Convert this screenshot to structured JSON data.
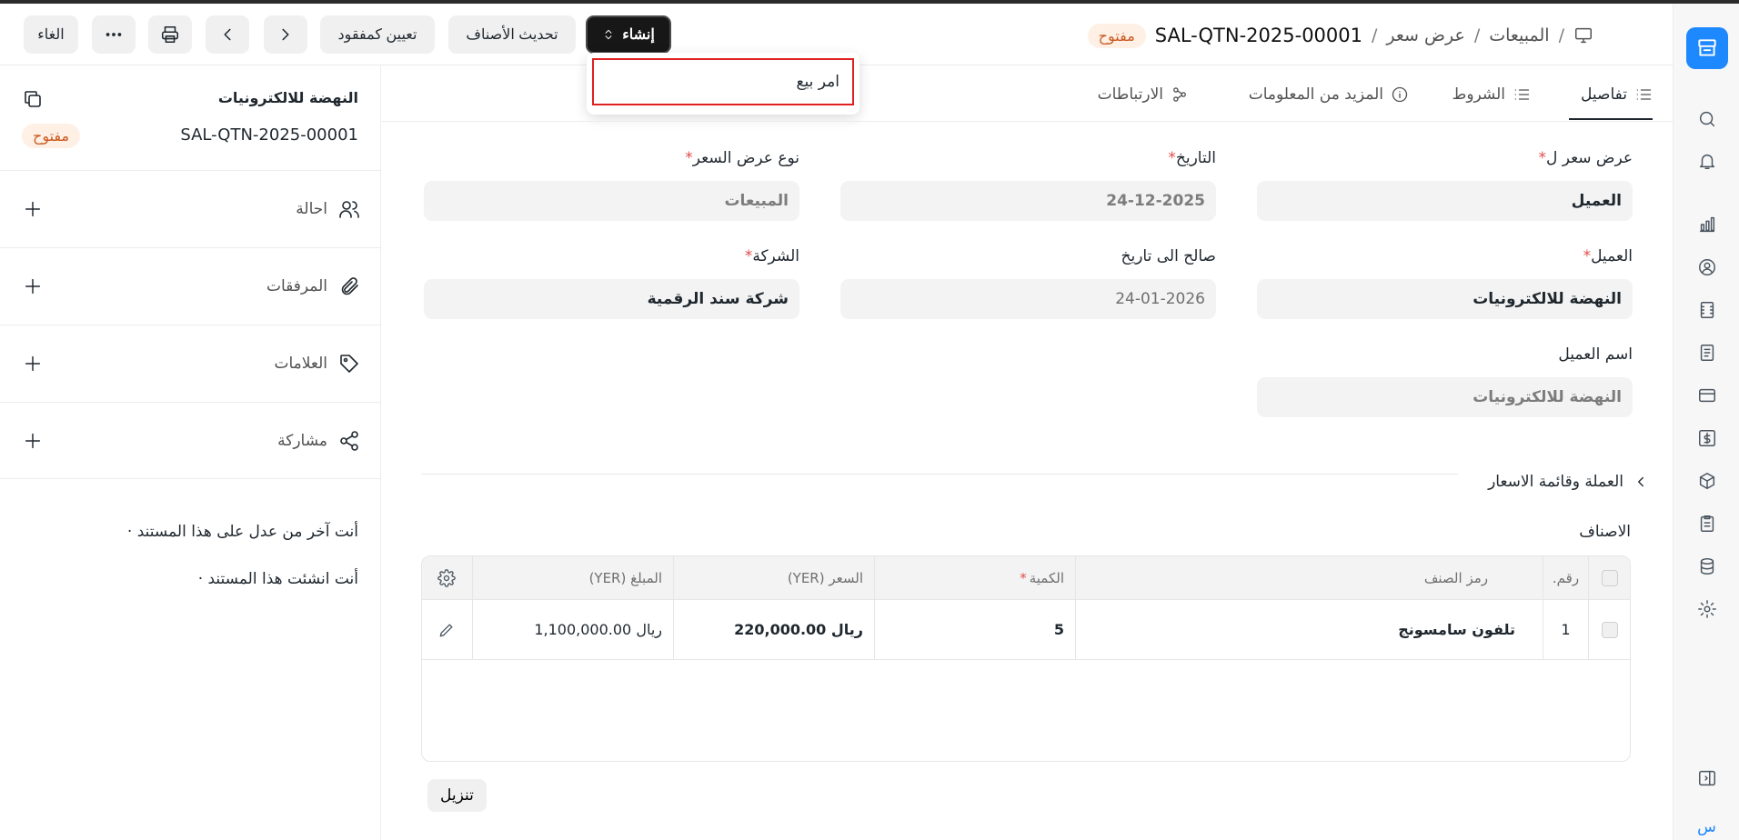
{
  "header": {
    "breadcrumb": [
      "المبيعات",
      "عرض سعر"
    ],
    "doc_title": "SAL-QTN-2025-00001",
    "status": "مفتوح",
    "buttons": {
      "create": "إنشاء",
      "update_items": "تحديث الأصناف",
      "set_lost": "تعيين كمفقود",
      "cancel": "الغاء"
    }
  },
  "dropdown": {
    "items": [
      "امر بيع"
    ]
  },
  "tabs": [
    "تفاصيل",
    "الشروط",
    "المزيد من المعلومات",
    "الارتباطات"
  ],
  "form": {
    "quotation_to_label": "عرض سعر ل",
    "quotation_to": "العميل",
    "date_label": "التاريخ",
    "date": "24-12-2025",
    "order_type_label": "نوع عرض السعر",
    "order_type": "المبيعات",
    "customer_label": "العميل",
    "customer": "النهضة للالكترونيات",
    "valid_till_label": "صالح الى تاريخ",
    "valid_till": "24-01-2026",
    "company_label": "الشركة",
    "company": "شركة سند الرقمية",
    "customer_name_label": "اسم العميل",
    "customer_name": "النهضة للالكترونيات"
  },
  "section": {
    "currency_pricelist": "العملة وقائمة الاسعار"
  },
  "items_table": {
    "title": "الاصناف",
    "headers": {
      "no": "رقم.",
      "item_code": "رمز الصنف",
      "qty": "الكمية",
      "rate": "السعر (YER)",
      "amount": "المبلغ (YER)"
    },
    "rows": [
      {
        "no": "1",
        "item_code": "تلفون سامسونج",
        "qty": "5",
        "rate": "ريال 220,000.00",
        "amount": "ريال 1,100,000.00"
      }
    ],
    "download": "تنزيل"
  },
  "sidebar": {
    "customer": "النهضة للالكترونيات",
    "doc_id": "SAL-QTN-2025-00001",
    "status": "مفتوح",
    "rows": [
      "احالة",
      "المرفقات",
      "العلامات",
      "مشاركة"
    ],
    "notes": [
      "أنت آخر من عدل على هذا المستند ·",
      "أنت انشئت هذا المستند ·"
    ]
  },
  "rail": {
    "bottom_letter": "س"
  }
}
